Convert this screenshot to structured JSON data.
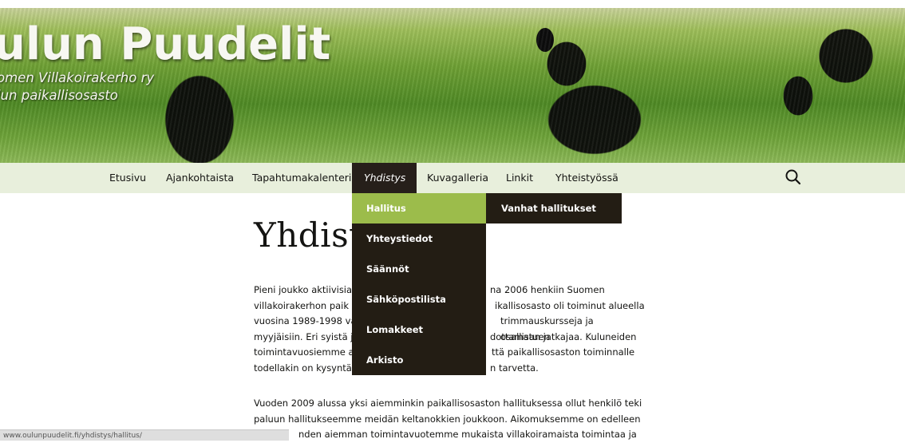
{
  "header": {
    "site_title": "ulun Puudelit",
    "site_description_line1": "omen Villakoirakerho ry",
    "site_description_line2": "lun paikallisosasto"
  },
  "nav": {
    "items": [
      {
        "label": "Etusivu"
      },
      {
        "label": "Ajankohtaista"
      },
      {
        "label": "Tapahtumakalenteri"
      },
      {
        "label": "Yhdistys",
        "active": true
      },
      {
        "label": "Kuvagalleria"
      },
      {
        "label": "Linkit"
      },
      {
        "label": "Yhteistyössä"
      }
    ],
    "search_icon": "search-icon"
  },
  "dropdown": {
    "items": [
      {
        "label": "Hallitus",
        "highlighted": true
      },
      {
        "label": "Yhteystiedot"
      },
      {
        "label": "Säännöt"
      },
      {
        "label": "Sähköpostilista"
      },
      {
        "label": "Lomakkeet"
      },
      {
        "label": "Arkisto"
      }
    ],
    "submenu_item": "Vanhat hallitukset"
  },
  "content": {
    "title": "Yhdist",
    "paragraph1": [
      {
        "left": "Pieni joukko aktiivisia",
        "right": "na 2006 henkiin Suomen"
      },
      {
        "left": "villakoirakerhon paik",
        "right": "ikallisosasto oli toiminut alueella"
      },
      {
        "left": "vuosina 1989-1998 va",
        "right": "trimmauskursseja ja osallistuen"
      },
      {
        "left": "myyjäisiin. Eri syistä j",
        "right": "dottamaan jatkajaa. Kuluneiden"
      },
      {
        "left": "toimintavuosiemme a",
        "right": "ttä paikallisosaston toiminnalle"
      },
      {
        "left": "todellakin on kysyntä",
        "right": "n tarvetta."
      }
    ],
    "paragraph2": [
      {
        "left": "Vuoden 2009 alussa yksi aiemminkin paikallisosaston hallituksessa ollut henkilö teki",
        "right": ""
      },
      {
        "left": "paluun hallitukseemme meidän keltanokkien joukkoon. Aikomuksemme on edelleen",
        "right": ""
      },
      {
        "left": "",
        "right": "nden aiemman toimintavuotemme mukaista villakoiramaista toimintaa ja"
      }
    ]
  },
  "statusbar": {
    "url": "www.oulunpuudelit.fi/yhdistys/hallitus/"
  },
  "colors": {
    "nav_background": "#e8efdc",
    "dropdown_background": "#231d14",
    "highlight": "#9cbc4b"
  }
}
